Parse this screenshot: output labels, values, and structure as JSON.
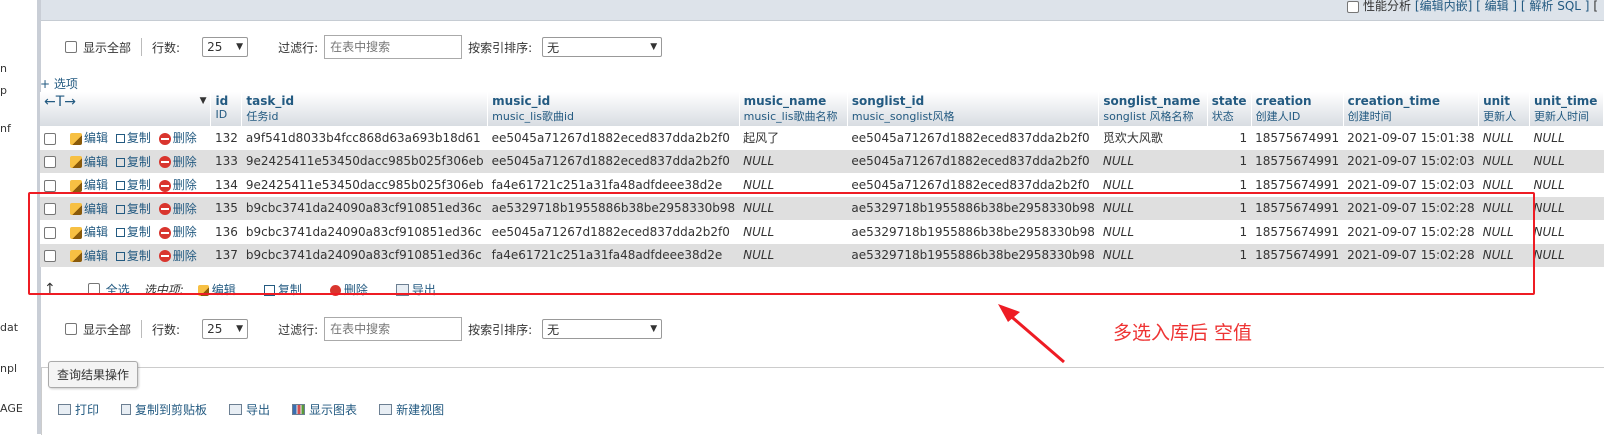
{
  "left_fragments": [
    "n",
    "p",
    "nf",
    "dat",
    "npl",
    "AGE"
  ],
  "topbar": {
    "perf_label": "性能分析",
    "edit_inline": "[编辑内嵌]",
    "edit": "[ 编辑 ]",
    "explain": "[ 解析 SQL ]",
    "trail": "["
  },
  "nav": {
    "show_all": "显示全部",
    "rows_label": "行数:",
    "rows_value": "25",
    "filter_label": "过滤行:",
    "filter_placeholder": "在表中搜索",
    "sort_label": "按索引排序:",
    "sort_value": "无"
  },
  "options_link": "+ 选项",
  "col_nav": "←T→",
  "columns": [
    {
      "name": "id",
      "comment": "ID"
    },
    {
      "name": "task_id",
      "comment": "任务id"
    },
    {
      "name": "music_id",
      "comment": "music_lis歌曲id"
    },
    {
      "name": "music_name",
      "comment": "music_lis歌曲名称"
    },
    {
      "name": "songlist_id",
      "comment": "music_songlist风格"
    },
    {
      "name": "songlist_name",
      "comment": "songlist 风格名称"
    },
    {
      "name": "state",
      "comment": "状态"
    },
    {
      "name": "creation",
      "comment": "创建人ID"
    },
    {
      "name": "creation_time",
      "comment": "创建时间"
    },
    {
      "name": "unit",
      "comment": "更新人"
    },
    {
      "name": "unit_time",
      "comment": "更新人时间"
    }
  ],
  "actions": {
    "edit": "编辑",
    "copy": "复制",
    "delete": "删除"
  },
  "rows": [
    {
      "id": "132",
      "task_id": "a9f541d8033b4fcc868d63a693b18d61",
      "music_id": "ee5045a71267d1882eced837dda2b2f0",
      "music_name": "起风了",
      "songlist_id": "ee5045a71267d1882eced837dda2b2f0",
      "songlist_name": "觅欢大风歌",
      "state": "1",
      "creation": "18575674991",
      "creation_time": "2021-09-07 15:01:38",
      "unit": "NULL",
      "unit_time": "NULL"
    },
    {
      "id": "133",
      "task_id": "9e2425411e53450dacc985b025f306eb",
      "music_id": "ee5045a71267d1882eced837dda2b2f0",
      "music_name": "NULL",
      "songlist_id": "ee5045a71267d1882eced837dda2b2f0",
      "songlist_name": "NULL",
      "state": "1",
      "creation": "18575674991",
      "creation_time": "2021-09-07 15:02:03",
      "unit": "NULL",
      "unit_time": "NULL"
    },
    {
      "id": "134",
      "task_id": "9e2425411e53450dacc985b025f306eb",
      "music_id": "fa4e61721c251a31fa48adfdeee38d2e",
      "music_name": "NULL",
      "songlist_id": "ee5045a71267d1882eced837dda2b2f0",
      "songlist_name": "NULL",
      "state": "1",
      "creation": "18575674991",
      "creation_time": "2021-09-07 15:02:03",
      "unit": "NULL",
      "unit_time": "NULL"
    },
    {
      "id": "135",
      "task_id": "b9cbc3741da24090a83cf910851ed36c",
      "music_id": "ae5329718b1955886b38be2958330b98",
      "music_name": "NULL",
      "songlist_id": "ae5329718b1955886b38be2958330b98",
      "songlist_name": "NULL",
      "state": "1",
      "creation": "18575674991",
      "creation_time": "2021-09-07 15:02:28",
      "unit": "NULL",
      "unit_time": "NULL"
    },
    {
      "id": "136",
      "task_id": "b9cbc3741da24090a83cf910851ed36c",
      "music_id": "ee5045a71267d1882eced837dda2b2f0",
      "music_name": "NULL",
      "songlist_id": "ae5329718b1955886b38be2958330b98",
      "songlist_name": "NULL",
      "state": "1",
      "creation": "18575674991",
      "creation_time": "2021-09-07 15:02:28",
      "unit": "NULL",
      "unit_time": "NULL"
    },
    {
      "id": "137",
      "task_id": "b9cbc3741da24090a83cf910851ed36c",
      "music_id": "fa4e61721c251a31fa48adfdeee38d2e",
      "music_name": "NULL",
      "songlist_id": "ae5329718b1955886b38be2958330b98",
      "songlist_name": "NULL",
      "state": "1",
      "creation": "18575674991",
      "creation_time": "2021-09-07 15:02:28",
      "unit": "NULL",
      "unit_time": "NULL"
    }
  ],
  "bulk": {
    "select_all": "全选",
    "selected": "选中项:",
    "edit": "编辑",
    "copy": "复制",
    "delete": "删除",
    "export": "导出"
  },
  "annotation": "多选入库后 空值",
  "ops": {
    "legend": "查询结果操作",
    "print": "打印",
    "copy_clipboard": "复制到剪贴板",
    "export": "导出",
    "chart": "显示图表",
    "new_view": "新建视图"
  },
  "colors": {
    "link": "#235a81",
    "highlight": "#ee1c24",
    "row_even": "#dfdfdf"
  }
}
